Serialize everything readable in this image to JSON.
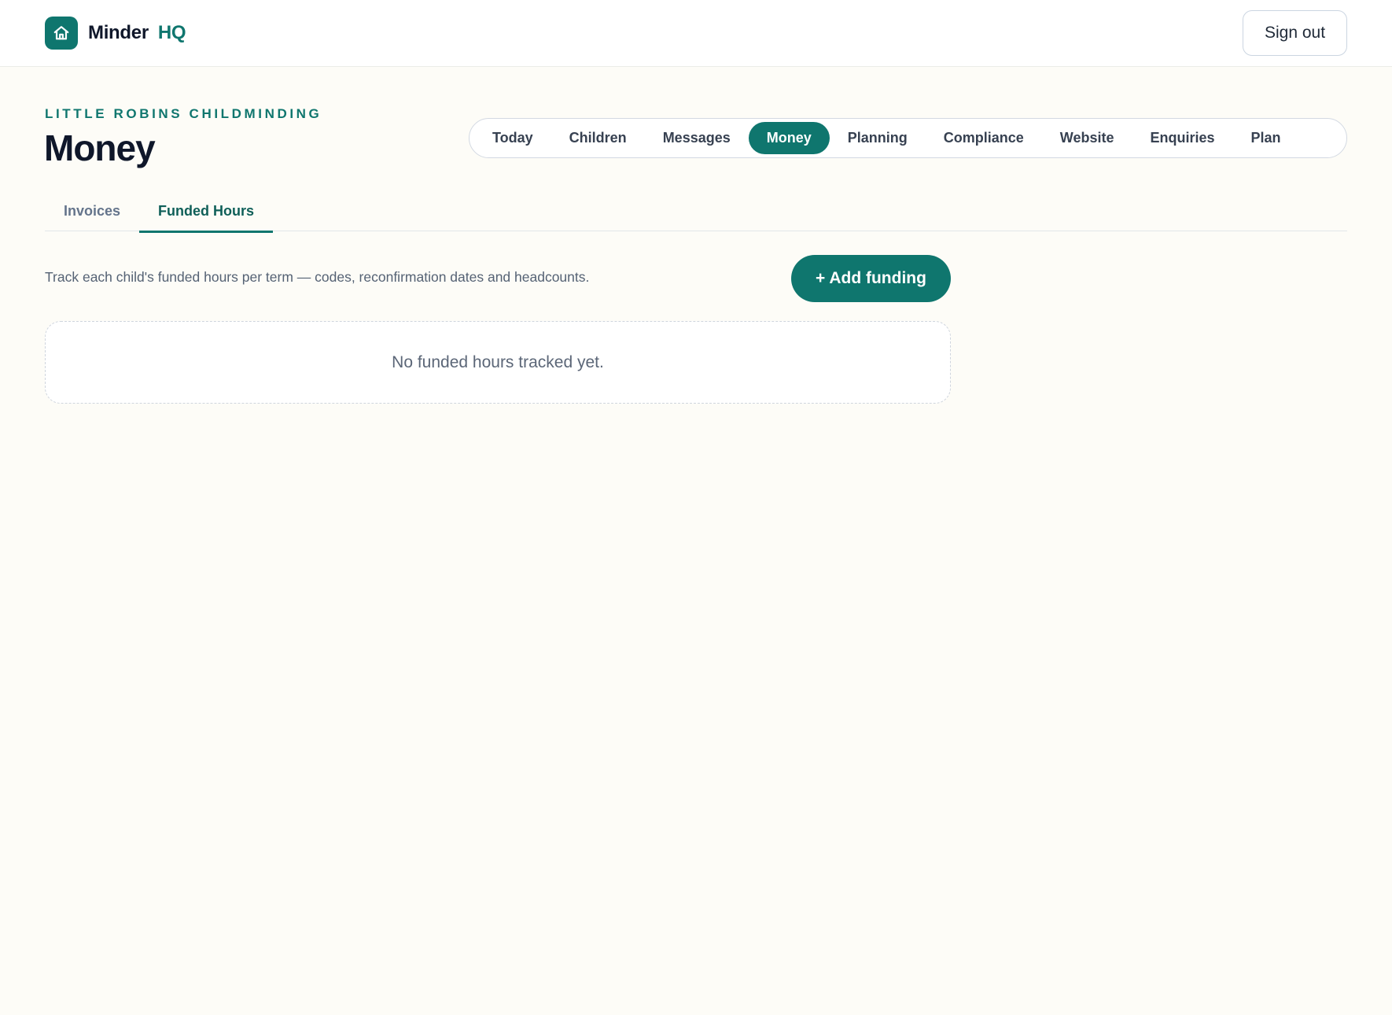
{
  "brand": {
    "name": "Minder",
    "accent": "HQ",
    "logo_icon": "home-icon",
    "color": "#0f766e"
  },
  "header": {
    "signout_label": "Sign out"
  },
  "page": {
    "eyebrow": "LITTLE ROBINS CHILDMINDING",
    "title": "Money"
  },
  "nav": {
    "items": [
      {
        "label": "Today",
        "active": false
      },
      {
        "label": "Children",
        "active": false
      },
      {
        "label": "Messages",
        "active": false
      },
      {
        "label": "Money",
        "active": true
      },
      {
        "label": "Planning",
        "active": false
      },
      {
        "label": "Compliance",
        "active": false
      },
      {
        "label": "Website",
        "active": false
      },
      {
        "label": "Enquiries",
        "active": false
      },
      {
        "label": "Plan",
        "active": false
      }
    ]
  },
  "subtabs": {
    "items": [
      {
        "label": "Invoices",
        "active": false
      },
      {
        "label": "Funded Hours",
        "active": true
      }
    ]
  },
  "funded": {
    "description": "Track each child's funded hours per term — codes, reconfirmation dates and headcounts.",
    "add_label": "+ Add funding",
    "empty_text": "No funded hours tracked yet."
  }
}
